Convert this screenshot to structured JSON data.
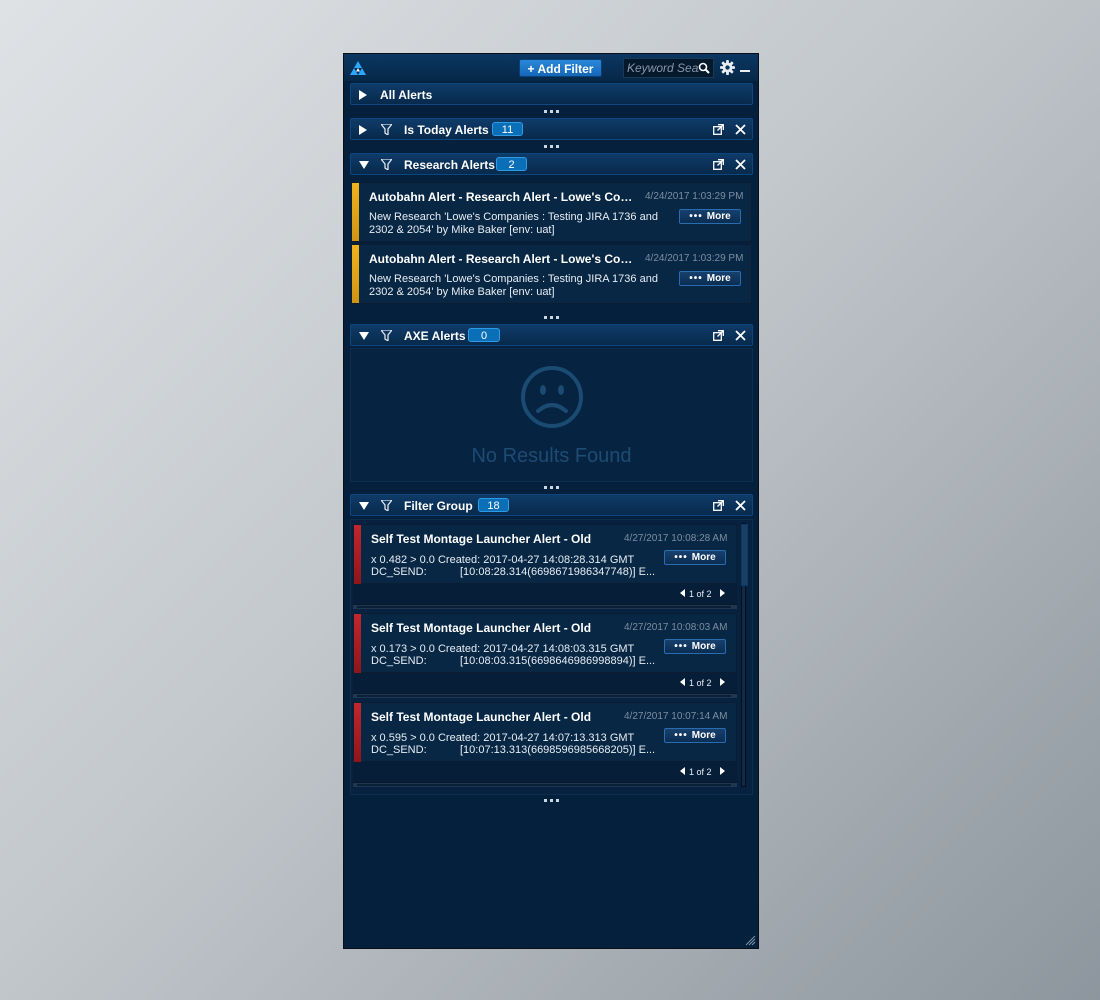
{
  "toolbar": {
    "add_filter_label": "+ Add Filter",
    "search_placeholder": "Keyword Search",
    "search_value": ""
  },
  "groups": {
    "all": {
      "title": "All Alerts"
    },
    "today": {
      "title": "Is Today Alerts",
      "count": "11"
    },
    "research": {
      "title": "Research Alerts",
      "count": "2",
      "alerts": [
        {
          "title": "Autobahn Alert - Research Alert - Lowe's Companies",
          "time": "4/24/2017 1:03:29 PM",
          "body": "New Research 'Lowe's Companies : Testing JIRA 1736 and 2302 & 2054' by Mike Baker   [env: uat]",
          "more": "More"
        },
        {
          "title": "Autobahn Alert - Research Alert - Lowe's Companies",
          "time": "4/24/2017 1:03:29 PM",
          "body": "New Research 'Lowe's Companies : Testing JIRA 1736 and 2302 & 2054' by Mike Baker   [env: uat]",
          "more": "More"
        }
      ]
    },
    "axe": {
      "title": "AXE Alerts",
      "count": "0",
      "empty_text": "No Results Found"
    },
    "filter": {
      "title": "Filter Group",
      "count": "18",
      "alerts": [
        {
          "title": "Self Test Montage Launcher Alert - Old",
          "time": "4/27/2017 10:08:28 AM",
          "line1": "x 0.482 > 0.0  Created: 2017-04-27 14:08:28.314 GMT",
          "line2_label": "DC_SEND:",
          "line2_value": "[10:08:28.314(6698671986347748)]  E...",
          "more": "More",
          "pager": "1 of 2"
        },
        {
          "title": "Self Test Montage Launcher Alert - Old",
          "time": "4/27/2017 10:08:03 AM",
          "line1": "x 0.173 > 0.0  Created: 2017-04-27 14:08:03.315 GMT",
          "line2_label": "DC_SEND:",
          "line2_value": "[10:08:03.315(6698646986998894)]  E...",
          "more": "More",
          "pager": "1 of 2"
        },
        {
          "title": "Self Test Montage Launcher Alert - Old",
          "time": "4/27/2017 10:07:14 AM",
          "line1": "x 0.595 > 0.0  Created: 2017-04-27 14:07:13.313 GMT",
          "line2_label": "DC_SEND:",
          "line2_value": "[10:07:13.313(6698596985668205)]  E...",
          "more": "More",
          "pager": "1 of 2"
        }
      ]
    }
  },
  "colors": {
    "research_accent": "#f1b21e",
    "filter_accent": "#c2272d",
    "badge": "#0b6fb8"
  },
  "icons": [
    "logo-icon",
    "search-icon",
    "gear-icon",
    "minimize-icon",
    "expand-arrow-icon",
    "collapse-arrow-icon",
    "filter-icon",
    "popout-icon",
    "close-icon",
    "sad-face-icon",
    "resize-grip-icon"
  ]
}
